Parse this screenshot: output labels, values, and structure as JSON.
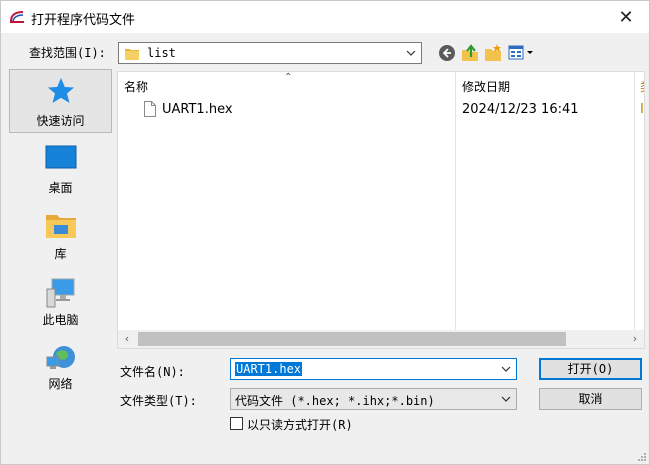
{
  "window": {
    "title": "打开程序代码文件",
    "close_glyph": "✕"
  },
  "look_in": {
    "label": "查找范围(I):",
    "value": "list"
  },
  "places": [
    {
      "label": "快速访问"
    },
    {
      "label": "桌面"
    },
    {
      "label": "库"
    },
    {
      "label": "此电脑"
    },
    {
      "label": "网络"
    }
  ],
  "file_list": {
    "columns": [
      "名称",
      "修改日期",
      "类"
    ],
    "rows": [
      {
        "name": "UART1.hex",
        "date": "2024/12/23 16:41",
        "type_fragment": "I"
      }
    ]
  },
  "file_name": {
    "label": "文件名(N):",
    "value": "UART1.hex"
  },
  "file_type": {
    "label": "文件类型(T):",
    "value": "代码文件 (*.hex;  *.ihx;*.bin)"
  },
  "readonly_check": {
    "label": "以只读方式打开(R)",
    "checked": false
  },
  "buttons": {
    "open": "打开(O)",
    "cancel": "取消"
  },
  "colors": {
    "accent": "#0078d7",
    "background": "#f0f0f0"
  }
}
